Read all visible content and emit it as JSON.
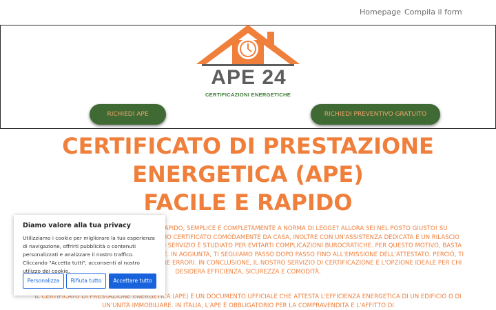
{
  "nav": {
    "home": "Homepage",
    "form": "Compila il form"
  },
  "logo": {
    "title": "APE 24",
    "subtitle": "CERTIFICAZIONI ENERGETICHE"
  },
  "buttons": {
    "request_ape": "RICHIEDI APE",
    "request_quote": "RICHIEDI PREVENTIVO GRATUITO"
  },
  "hero": {
    "line1": "CERTIFICATO DI PRESTAZIONE",
    "line2": "ENERGETICA (APE)",
    "line3": "FACILE E RAPIDO"
  },
  "paragraphs": {
    "p1": "Cerchi un certificato APE online rapido, semplice e completamente a norma di legge? Allora sei nel posto giusto! Su certificatoape.eu puoi richiedere il tuo certificato comodamente da casa, inoltre con un'assistenza dedicata e un rilascio valido in tutta Italia. Infatti, il nostro servizio è studiato per evitarti complicazioni burocratiche. Per questo motivo, basta compilare il modulo online per iniziare. In aggiunta, ti seguiamo passo dopo passo fino all'emissione dell'attestato. Perciò, ti aiutiamo a risparmiare tempo ed evitare errori. In conclusione, il nostro servizio di certificazione è l'opzione ideale per chi desidera efficienza, sicurezza e comodità.",
    "p2": "Il certificato di prestazione energetica (APE) è un documento ufficiale che attesta l'efficienza energetica di un edificio o di un'unità immobiliare. In Italia, l'APE è obbligatorio per la compravendita e l'affitto di"
  },
  "cookie": {
    "title": "Diamo valore alla tua privacy",
    "text": "Utilizziamo i cookie per migliorare la tua esperienza di navigazione, offrirti pubblicità o contenuti personalizzati e analizzare il nostro traffico. Cliccando \"Accetta tutti\", acconsenti al nostro utilizzo dei cookie.",
    "customize": "Personalizza",
    "reject": "Rifiuta tutto",
    "accept": "Accettare tutto"
  },
  "colors": {
    "accent": "#ef7f3b",
    "green": "#3f6a34",
    "cookie_blue": "#1863dc"
  }
}
